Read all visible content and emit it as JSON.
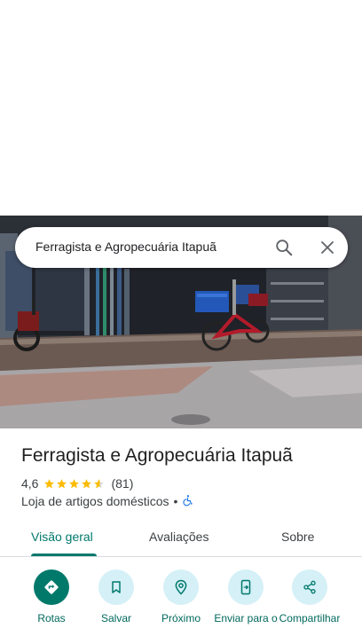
{
  "search": {
    "query": "Ferragista e Agropecuária Itapuã"
  },
  "place": {
    "title": "Ferragista e Agropecuária Itapuã",
    "rating": "4,6",
    "stars": 4.6,
    "review_count": "(81)",
    "category": "Loja de artigos domésticos",
    "separator": "•",
    "wheelchair_icon": "wheelchair-accessible-icon"
  },
  "tabs": [
    {
      "label": "Visão geral",
      "active": true
    },
    {
      "label": "Avaliações",
      "active": false
    },
    {
      "label": "Sobre",
      "active": false
    }
  ],
  "actions": [
    {
      "label": "Rotas",
      "icon": "directions-icon"
    },
    {
      "label": "Salvar",
      "icon": "bookmark-icon"
    },
    {
      "label": "Próximo",
      "icon": "nearby-icon"
    },
    {
      "label": "Enviar para o",
      "icon": "send-to-phone-icon"
    },
    {
      "label": "Compartilhar",
      "icon": "share-icon"
    }
  ],
  "colors": {
    "accent": "#00796b",
    "action_bg": "#d5f0f7",
    "star": "#fbbc04"
  }
}
